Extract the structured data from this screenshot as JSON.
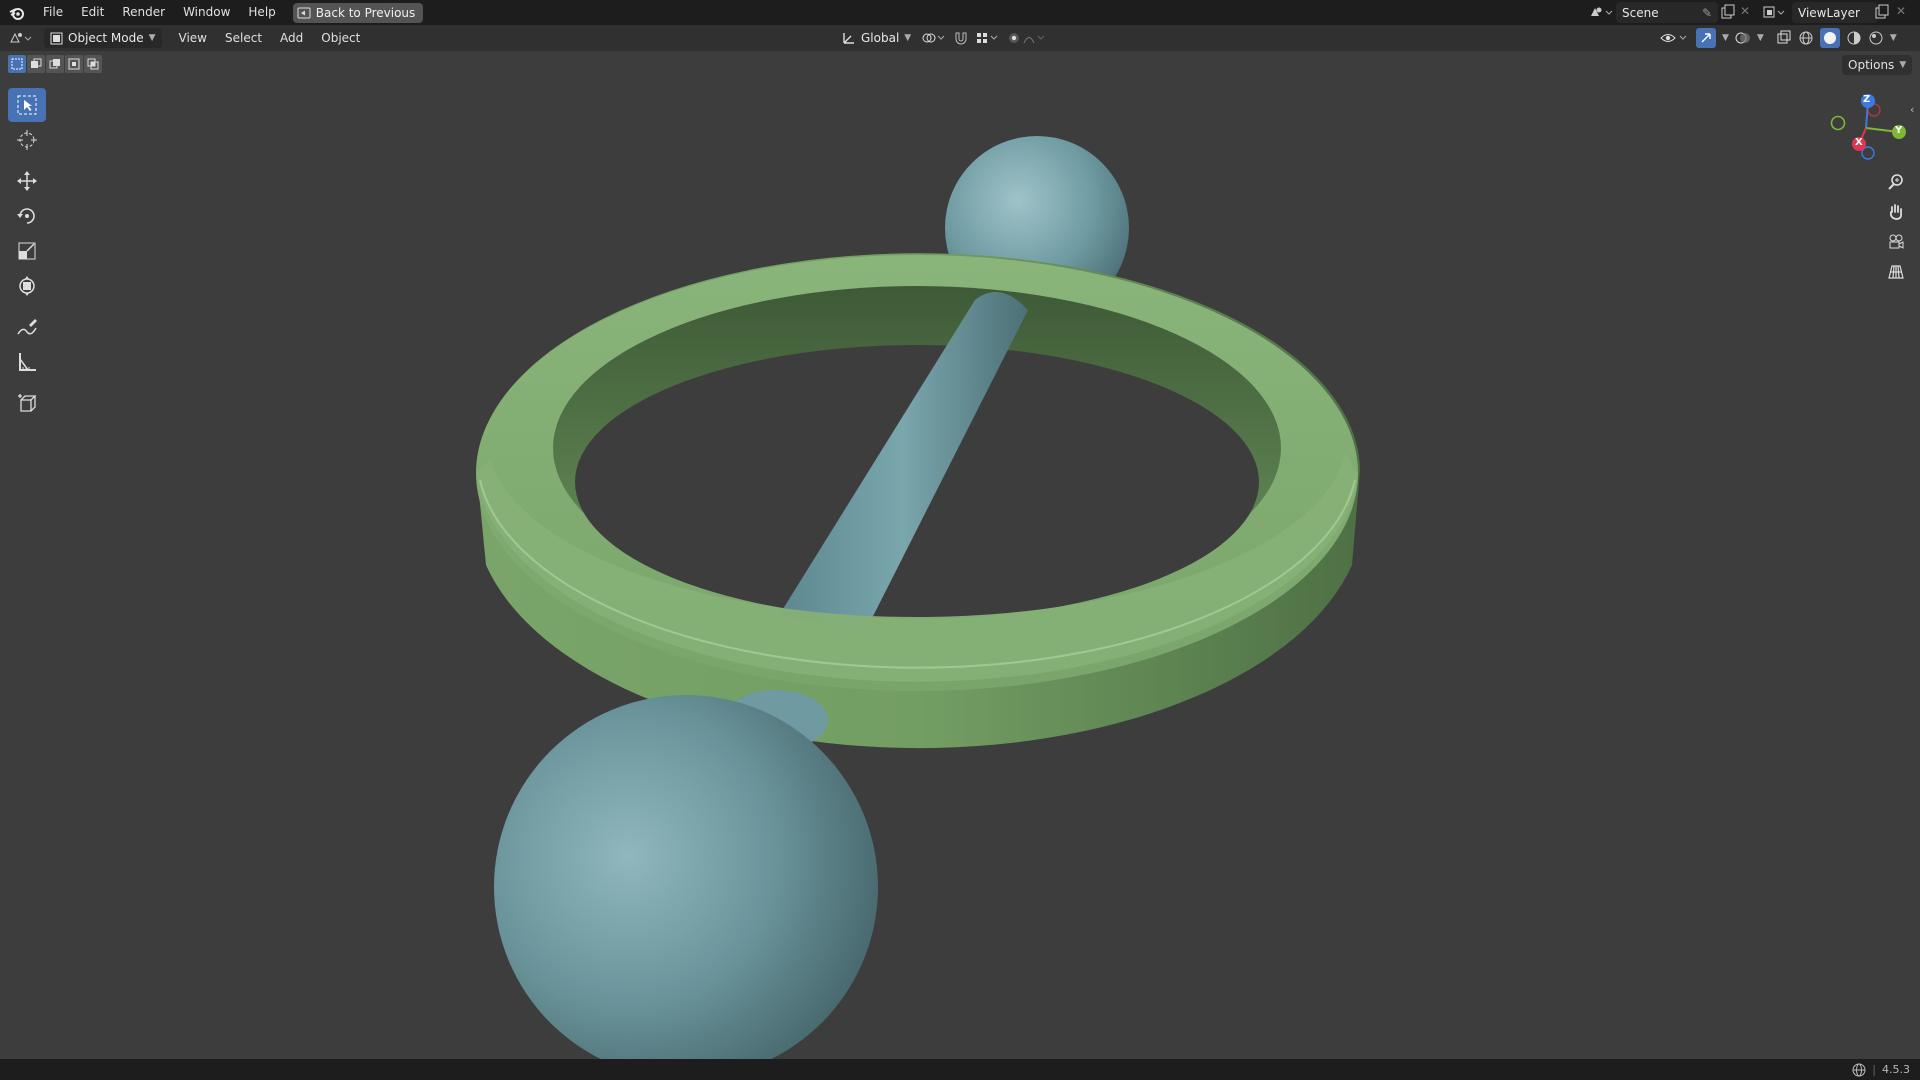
{
  "topbar": {
    "menus": [
      "File",
      "Edit",
      "Render",
      "Window",
      "Help"
    ],
    "back_label": "Back to Previous",
    "scene_label": "Scene",
    "view_layer_label": "ViewLayer"
  },
  "header": {
    "mode_label": "Object Mode",
    "menus": [
      "View",
      "Select",
      "Add",
      "Object"
    ],
    "orientation_label": "Global",
    "options_label": "Options"
  },
  "gizmo": {
    "x": "X",
    "y": "Y",
    "z": "Z"
  },
  "statusbar": {
    "version": "4.5.3"
  },
  "colors": {
    "accent": "#4772b3",
    "ring": "#6f9a5f",
    "spheres": "#6c9aa3",
    "background": "#3d3d3d"
  }
}
